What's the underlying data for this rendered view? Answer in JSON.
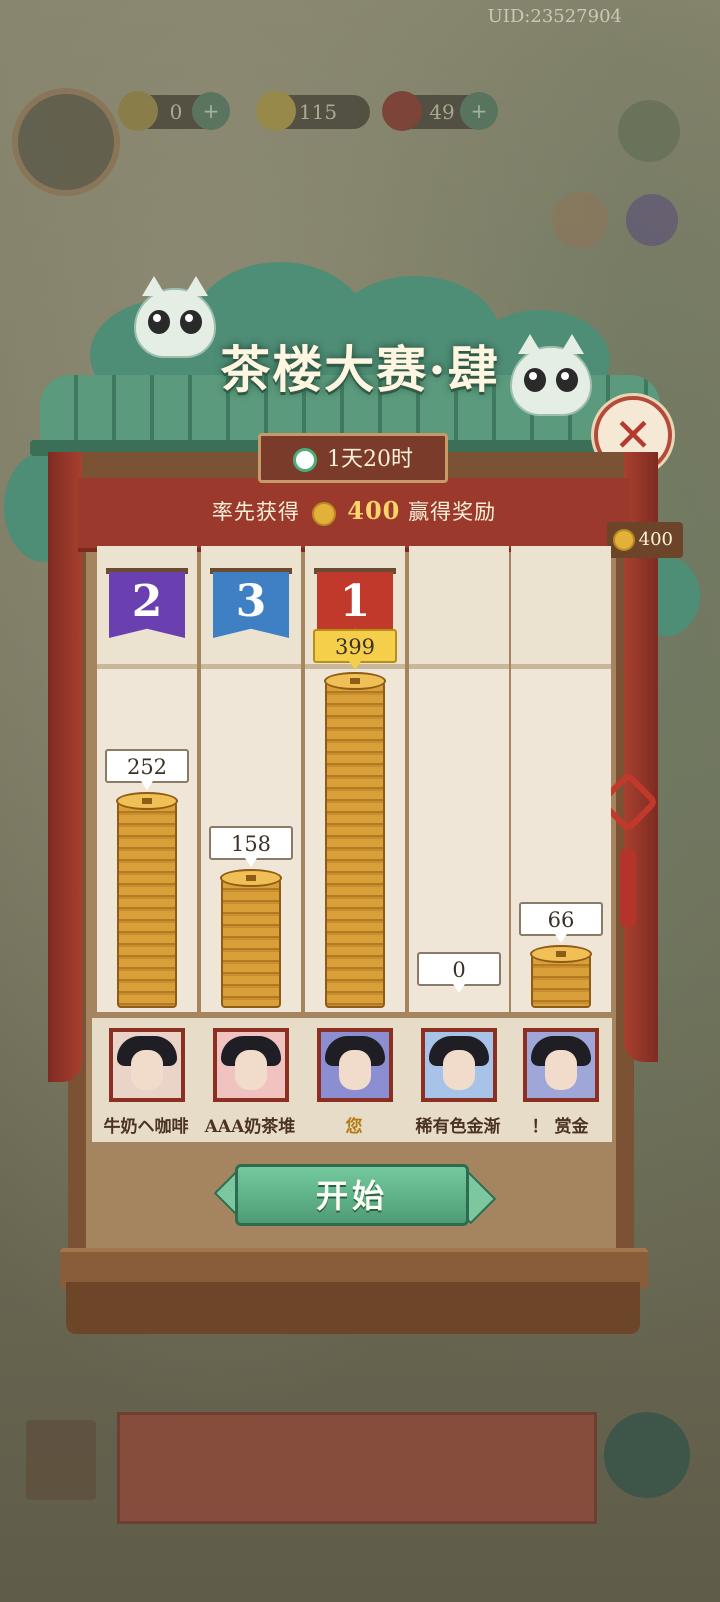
{
  "uid": "UID:23527904",
  "hud": {
    "energy": "0",
    "coins": "115",
    "gems": "49",
    "plus": "+"
  },
  "modal": {
    "title": "茶楼大赛·肆",
    "timer": "1天20时",
    "goal_prefix": "率先获得",
    "goal_amount": "400",
    "goal_suffix": "赢得奖励",
    "side_goal": "400",
    "close_symbol": "✕",
    "start_label": "开始"
  },
  "players": [
    {
      "name": "牛奶ヘ咖啡",
      "score": "252",
      "rank": "2",
      "coins": 252,
      "is_you": false
    },
    {
      "name": "AAA奶茶堆",
      "score": "158",
      "rank": "3",
      "coins": 158,
      "is_you": false
    },
    {
      "name": "您",
      "score": "399",
      "rank": "1",
      "coins": 399,
      "is_you": true
    },
    {
      "name": "稀有色金渐",
      "score": "0",
      "rank": "",
      "coins": 0,
      "is_you": false
    },
    {
      "name": "！ 赏金",
      "score": "66",
      "rank": "",
      "coins": 66,
      "is_you": false
    }
  ],
  "colors": {
    "rank1": "#c0392b",
    "rank2": "#6a3fb0",
    "rank3": "#3f7fc4",
    "accent_green": "#4e9c76"
  }
}
